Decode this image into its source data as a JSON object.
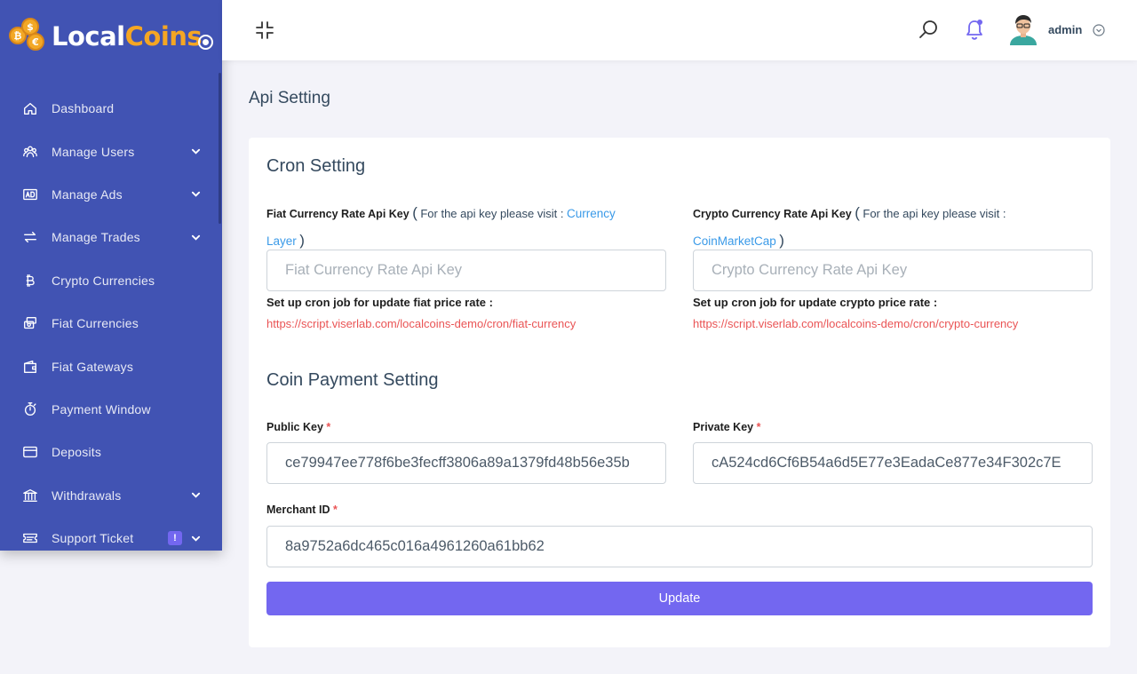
{
  "brand": {
    "name_white": "Local",
    "name_yellow": "Coins"
  },
  "sidebar": {
    "items": [
      {
        "label": "Dashboard",
        "icon": "home-icon",
        "has_submenu": false
      },
      {
        "label": "Manage Users",
        "icon": "users-icon",
        "has_submenu": true
      },
      {
        "label": "Manage Ads",
        "icon": "ad-icon",
        "has_submenu": true
      },
      {
        "label": "Manage Trades",
        "icon": "exchange-icon",
        "has_submenu": true
      },
      {
        "label": "Crypto Currencies",
        "icon": "bitcoin-icon",
        "has_submenu": false
      },
      {
        "label": "Fiat Currencies",
        "icon": "money-icon",
        "has_submenu": false
      },
      {
        "label": "Fiat Gateways",
        "icon": "wallet-icon",
        "has_submenu": false
      },
      {
        "label": "Payment Window",
        "icon": "stopwatch-icon",
        "has_submenu": false
      },
      {
        "label": "Deposits",
        "icon": "credit-card-icon",
        "has_submenu": false
      },
      {
        "label": "Withdrawals",
        "icon": "bank-icon",
        "has_submenu": true
      },
      {
        "label": "Support Ticket",
        "icon": "ticket-icon",
        "has_submenu": true,
        "badge": "!"
      }
    ]
  },
  "header": {
    "user_name": "admin"
  },
  "page": {
    "title": "Api Setting"
  },
  "cron": {
    "title": "Cron Setting",
    "fiat": {
      "label": "Fiat Currency Rate Api Key",
      "note": "For the api key please visit :",
      "link_line1": "Currency",
      "link_line2": "Layer",
      "placeholder": "Fiat Currency Rate Api Key",
      "value": "",
      "cron_title": "Set up cron job for update fiat price rate :",
      "cron_url": "https://script.viserlab.com/localcoins-demo/cron/fiat-currency"
    },
    "crypto": {
      "label": "Crypto Currency Rate Api Key",
      "note": "For the api key please visit :",
      "link": "CoinMarketCap",
      "placeholder": "Crypto Currency Rate Api Key",
      "value": "",
      "cron_title": "Set up cron job for update crypto price rate :",
      "cron_url": "https://script.viserlab.com/localcoins-demo/cron/crypto-currency"
    }
  },
  "coin_payment": {
    "title": "Coin Payment Setting",
    "public_key": {
      "label": "Public Key",
      "value": "ce79947ee778f6be3fecff3806a89a1379fd48b56e35b"
    },
    "private_key": {
      "label": "Private Key",
      "value": "cA524cd6Cf6B54a6d5E77e3EadaCe877e34F302c7E"
    },
    "merchant_id": {
      "label": "Merchant ID",
      "value": "8a9752a6dc465c016a4961260a61bb62"
    }
  },
  "actions": {
    "update_label": "Update"
  },
  "colors": {
    "sidebar": "#4153b3",
    "accent": "#7367f0",
    "brand_yellow": "#f5a623",
    "link": "#3a9ae8",
    "danger": "#ea5455"
  }
}
